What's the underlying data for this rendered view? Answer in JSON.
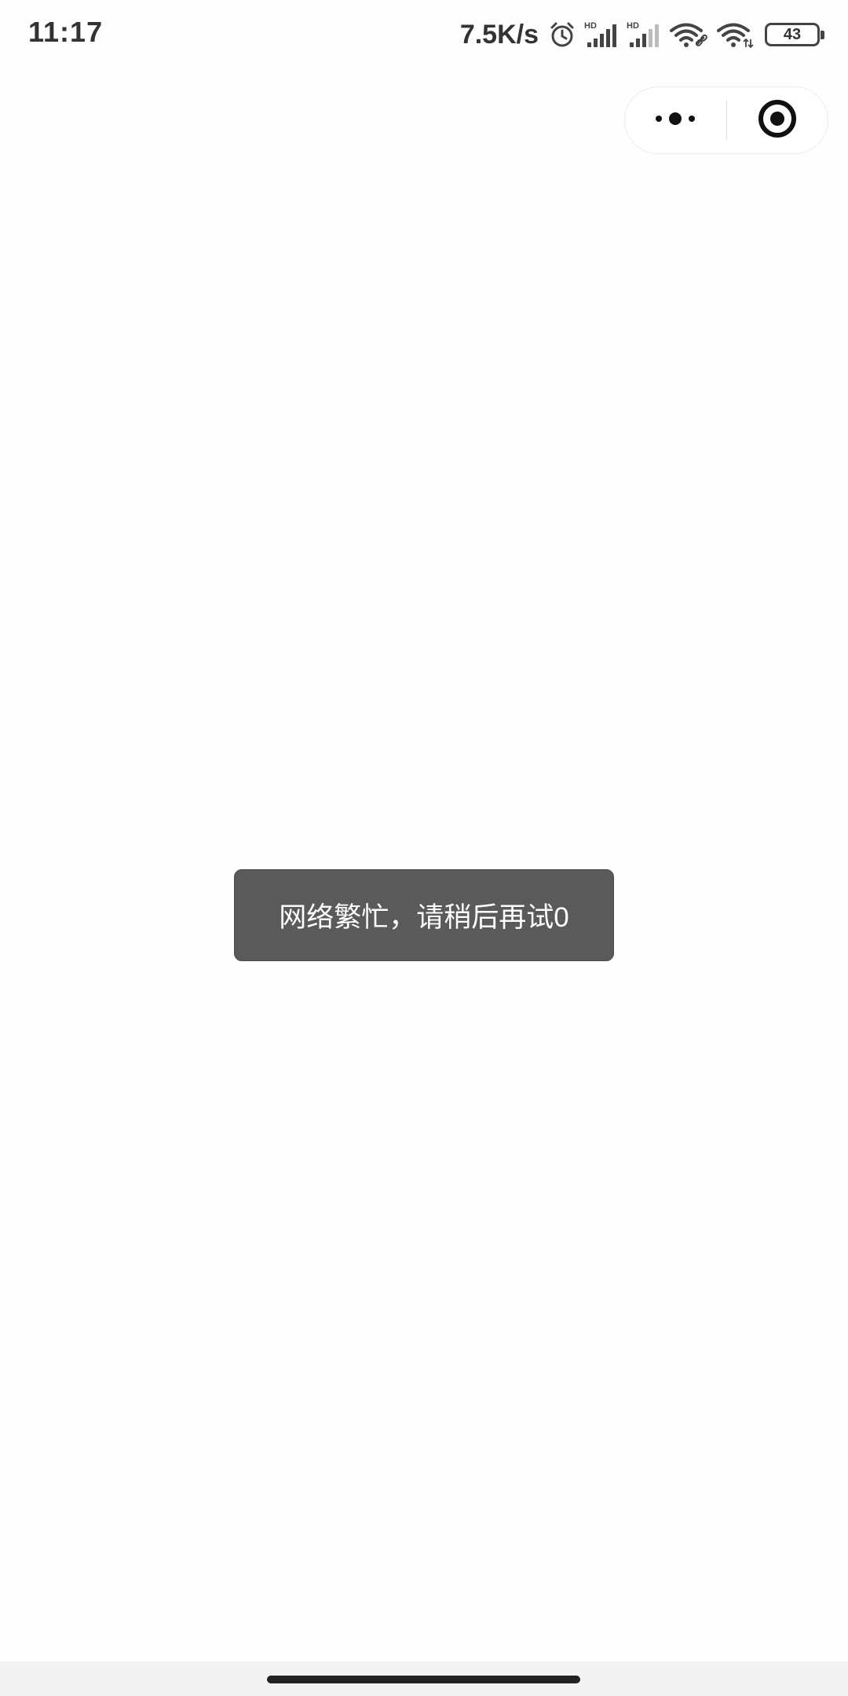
{
  "status_bar": {
    "time": "11:17",
    "net_speed": "7.5K/s",
    "battery_level": "43",
    "icons": [
      "alarm-icon",
      "signal-hd-icon",
      "signal-hd-icon",
      "wifi-link-icon",
      "wifi-icon",
      "battery-icon"
    ]
  },
  "capsule": {
    "icons": [
      "more-dots-icon",
      "close-target-icon"
    ]
  },
  "toast": {
    "message": "网络繁忙，请稍后再试0"
  },
  "colors": {
    "toast_background": "#5a5a5a",
    "toast_text": "#ffffff",
    "status_text": "#333333"
  }
}
